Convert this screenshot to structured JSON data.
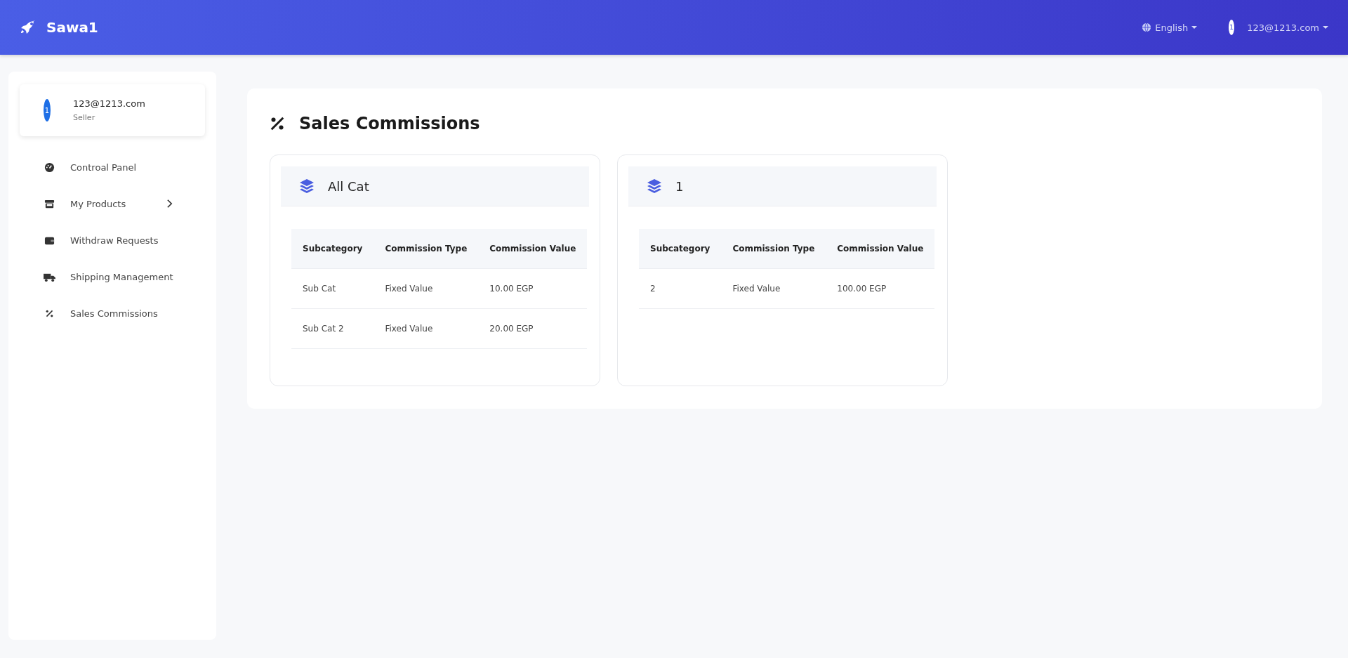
{
  "header": {
    "brand": "Sawa1",
    "language": "English",
    "avatar_initial": "1",
    "user": "123@1213.com"
  },
  "sidebar": {
    "profile": {
      "avatar_initial": "1",
      "email": "123@1213.com",
      "role": "Seller"
    },
    "items": [
      {
        "label": "Controal Panel",
        "kind": "link"
      },
      {
        "label": "My Products",
        "kind": "group"
      },
      {
        "label": "Withdraw Requests",
        "kind": "link"
      },
      {
        "label": "Shipping Management",
        "kind": "link"
      },
      {
        "label": "Sales Commissions",
        "kind": "link"
      }
    ]
  },
  "page": {
    "title": "Sales Commissions",
    "categories": [
      {
        "name": "All Cat",
        "columns": [
          "Subcategory",
          "Commission Type",
          "Commission Value"
        ],
        "rows": [
          [
            "Sub Cat",
            "Fixed Value",
            "10.00 EGP"
          ],
          [
            "Sub Cat 2",
            "Fixed Value",
            "20.00 EGP"
          ]
        ]
      },
      {
        "name": "1",
        "columns": [
          "Subcategory",
          "Commission Type",
          "Commission Value"
        ],
        "rows": [
          [
            "2",
            "Fixed Value",
            "100.00 EGP"
          ]
        ]
      }
    ]
  }
}
